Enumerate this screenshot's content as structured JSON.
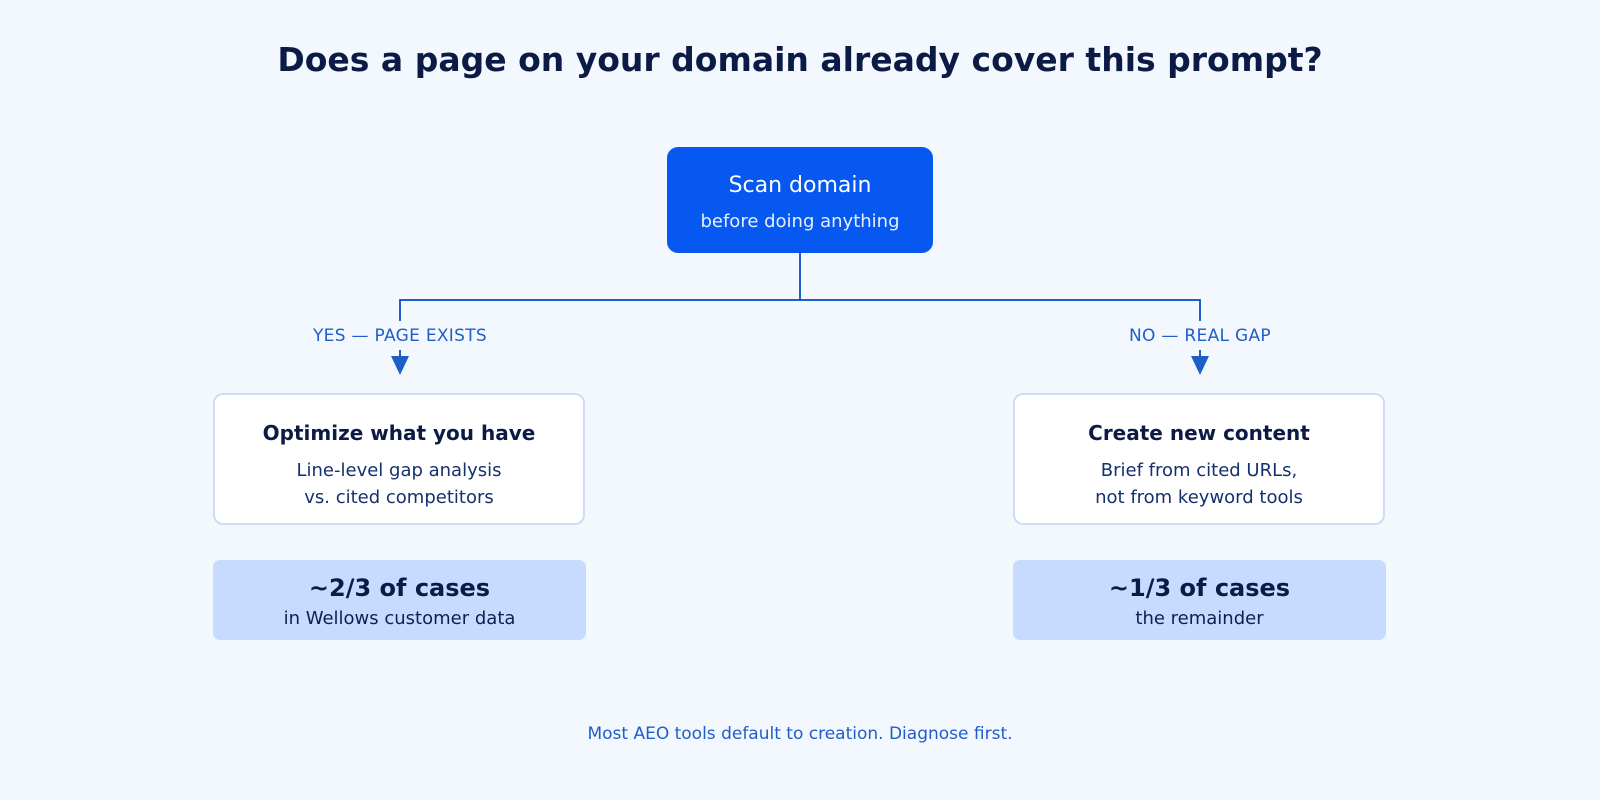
{
  "title": "Does a page on your domain already cover this prompt?",
  "root": {
    "title": "Scan domain",
    "subtitle": "before doing anything"
  },
  "branches": {
    "yes": {
      "label": "YES — PAGE EXISTS",
      "card_title": "Optimize what you have",
      "card_line1": "Line-level gap analysis",
      "card_line2": "vs. cited competitors",
      "stat_value": "~2/3 of cases",
      "stat_caption": "in Wellows customer data"
    },
    "no": {
      "label": "NO — REAL GAP",
      "card_title": "Create new content",
      "card_line1": "Brief from cited URLs,",
      "card_line2": "not from keyword tools",
      "stat_value": "~1/3 of cases",
      "stat_caption": "the remainder"
    }
  },
  "footer": "Most AEO tools default to creation. Diagnose first.",
  "colors": {
    "background": "#f3f7fe",
    "primary": "#0658f0",
    "connector": "#1f5ec9",
    "stat_fill": "#c6dbfd",
    "text_dark": "#0b1b45"
  }
}
